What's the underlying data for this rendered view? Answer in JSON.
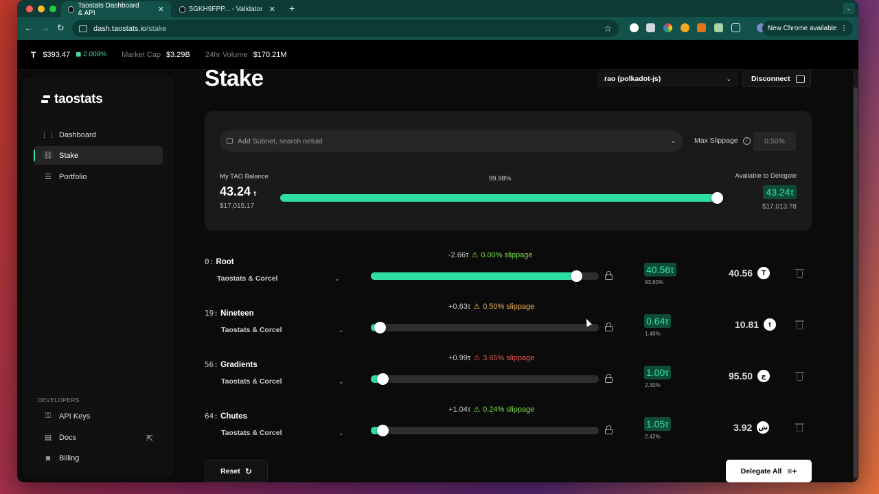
{
  "browser": {
    "tabs": [
      {
        "title": "Taostats Dashboard & API",
        "active": true
      },
      {
        "title": "5GKH9FPP... - Validator - tao",
        "active": false
      }
    ],
    "url_host": "dash.taostats.io",
    "url_path": "/stake",
    "update_label": "New Chrome available"
  },
  "ticker": {
    "price": "$393.47",
    "change": "2.009%",
    "market_cap_label": "Market Cap",
    "market_cap": "$3.29B",
    "volume_label": "24hr Volume",
    "volume": "$170.21M"
  },
  "sidebar": {
    "logo": "taostats",
    "items": [
      {
        "label": "Dashboard",
        "icon": "grid-icon",
        "active": false
      },
      {
        "label": "Stake",
        "icon": "link-icon",
        "active": true
      },
      {
        "label": "Portfolio",
        "icon": "database-icon",
        "active": false
      }
    ],
    "developers_label": "DEVELOPERS",
    "dev_items": [
      {
        "label": "API Keys",
        "icon": "key-icon"
      },
      {
        "label": "Docs",
        "icon": "document-icon"
      },
      {
        "label": "Billing",
        "icon": "billing-icon"
      }
    ]
  },
  "page": {
    "title": "Stake",
    "wallet": "rao (polkadot-js)",
    "disconnect": "Disconnect"
  },
  "balance_card": {
    "search_placeholder": "Add Subnet, search netuid",
    "max_slippage_label": "Max Slippage",
    "max_slippage_value": "0.50%",
    "balance_label": "My TAO Balance",
    "balance": "43.24",
    "balance_unit": "τ",
    "balance_usd": "$17,015.17",
    "allocation_pct": "99.98%",
    "allocation_fraction": 0.9998,
    "available_label": "Available to Delegate",
    "available": "43.24τ",
    "available_usd": "$17,013.78"
  },
  "rows": [
    {
      "netuid": "0:",
      "name": "Root",
      "validator": "Taostats & Corcel",
      "change": "-2.66τ",
      "slippage": "0.00% slippage",
      "slippage_level": "ok",
      "fill": 0.9,
      "stake": "40.56τ",
      "pct": "93.80%",
      "alpha": "40.56",
      "symbol": "T"
    },
    {
      "netuid": "19:",
      "name": "Nineteen",
      "validator": "Taostats & Corcel",
      "change": "+0.63τ",
      "slippage": "0.50% slippage",
      "slippage_level": "warn",
      "fill": 0.04,
      "stake": "0.64τ",
      "pct": "1.48%",
      "alpha": "10.81",
      "symbol": "t"
    },
    {
      "netuid": "56:",
      "name": "Gradients",
      "validator": "Taostats & Corcel",
      "change": "+0.99τ",
      "slippage": "3.65% slippage",
      "slippage_level": "high",
      "fill": 0.05,
      "stake": "1.00τ",
      "pct": "2.30%",
      "alpha": "95.50",
      "symbol": "ج"
    },
    {
      "netuid": "64:",
      "name": "Chutes",
      "validator": "Taostats & Corcel",
      "change": "+1.04τ",
      "slippage": "0.24% slippage",
      "slippage_level": "ok",
      "fill": 0.05,
      "stake": "1.05τ",
      "pct": "2.42%",
      "alpha": "3.92",
      "symbol": "ش"
    }
  ],
  "actions": {
    "reset": "Reset",
    "delegate_all": "Delegate All"
  },
  "colors": {
    "accent": "#2ee0a3",
    "warn": "#f0b35a",
    "danger": "#ef5a5a",
    "ok": "#7ee04a"
  }
}
